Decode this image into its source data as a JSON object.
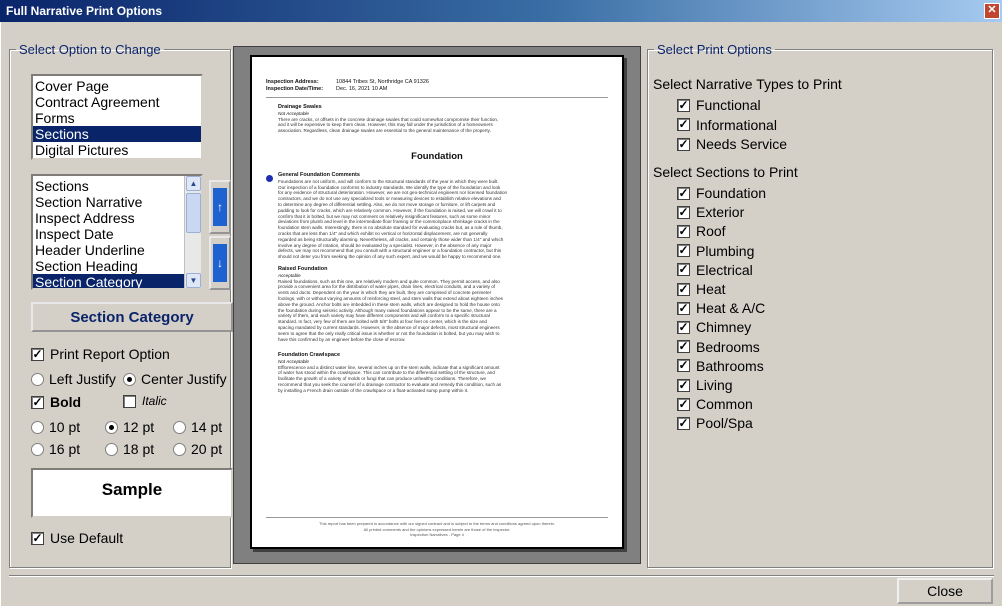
{
  "window": {
    "title": "Full Narrative Print Options",
    "close_glyph": "✕"
  },
  "left_group": {
    "legend": "Select Option to Change",
    "options": [
      {
        "label": "Cover Page",
        "selected": false
      },
      {
        "label": "Contract Agreement",
        "selected": false
      },
      {
        "label": "Forms",
        "selected": false
      },
      {
        "label": "Sections",
        "selected": true
      },
      {
        "label": "Digital Pictures",
        "selected": false
      }
    ],
    "elements": [
      {
        "label": "Sections",
        "selected": false
      },
      {
        "label": "Section Narrative",
        "selected": false
      },
      {
        "label": "Inspect Address",
        "selected": false
      },
      {
        "label": "Inspect Date",
        "selected": false
      },
      {
        "label": "Header Underline",
        "selected": false
      },
      {
        "label": "Section Heading",
        "selected": false
      },
      {
        "label": "Section Category",
        "selected": true
      }
    ],
    "move_up_glyph": "↑",
    "move_down_glyph": "↓",
    "current_heading": "Section Category",
    "print_report_option": {
      "label": "Print Report Option",
      "checked": true
    },
    "justify": {
      "left_label": "Left Justify",
      "center_label": "Center Justify",
      "selected": "center"
    },
    "bold": {
      "label": "Bold",
      "checked": true
    },
    "italic": {
      "label": "Italic",
      "checked": false
    },
    "sizes": [
      {
        "label": "10 pt",
        "selected": false
      },
      {
        "label": "12 pt",
        "selected": true
      },
      {
        "label": "14 pt",
        "selected": false
      },
      {
        "label": "16 pt",
        "selected": false
      },
      {
        "label": "18 pt",
        "selected": false
      },
      {
        "label": "20 pt",
        "selected": false
      }
    ],
    "sample_text": "Sample",
    "use_default": {
      "label": "Use Default",
      "checked": true
    }
  },
  "preview": {
    "address_label": "Inspection Address:",
    "address_value": "10844 Tribes St, Northridge CA 91326",
    "date_label": "Inspection Date/Time:",
    "date_value": "Dec. 16, 2021 10 AM",
    "drainage": {
      "title": "Drainage Swales",
      "status": "Not Acceptable",
      "lines": [
        "There are cracks, or offsets in the concrete drainage swales that could somewhat compromise their function,",
        "and it will be expensive to keep them clean. However, this may fall under the jurisdiction of a homeowners",
        "association. Regardless, clean drainage swales are essential to the general maintenance of the property."
      ]
    },
    "section_heading": "Foundation",
    "general": {
      "title": "General Foundation Comments",
      "lines": [
        "Foundations are not uniform, and will conform to the structural standards of the year in which they were built.",
        "Our inspection of a foundation conforms to industry standards. We identify the type of the foundation and look",
        "for any evidence of structural deterioration. However, we are not geo-technical engineers nor licensed foundation",
        "contractors, and we do not use any specialized tools or measuring devices to establish relative elevations and",
        "to determine any degree of differential settling. Also, we do not move storage or furniture, or lift carpets and",
        "padding to look for cracks, which are relatively common. However, if the foundation is raised, we will crawl it to",
        "confirm that it is bolted, but we may not comment on relatively insignificant features, such as some minor",
        "deviations from plumb and level in the intermediate floor framing or the commonplace shrinkage cracks in the",
        "foundation stem walls. Interestingly, there is no absolute standard for evaluating cracks but, as a rule of thumb,",
        "cracks that are less than 1/4\" and which exhibit no vertical or horizontal displacement, are not generally",
        "regarded as being structurally alarming. Nevertheless, all cracks, and certainly those wider than 1/4\" and which",
        "involve any degree of rotation, should be evaluated by a specialist. However, in the absence of any major",
        "defects, we may not recommend that you consult with a structural engineer or a foundation contractor, but this",
        "should not deter you from seeking the opinion of any such expert, and we would be happy to recommend one."
      ]
    },
    "raised": {
      "title": "Raised Foundation",
      "status": "Acceptable",
      "lines": [
        "Raised foundations, such as this one, are relatively modern and quite common. They permit access, and also",
        "provide a convenient area for the distribution of water pipes, drain lines, electrical conduits, and a variety of",
        "vents and ducts. Dependent on the year in which they are built, they are comprised of concrete perimeter",
        "footings, with or without varying amounts of reinforcing steel, and stem walls that extend about eighteen inches",
        "above the ground. Anchor bolts are imbedded in these stem walls, which are designed to hold the house onto",
        "the foundation during seismic activity. Although many raised foundations appear to be the same, there are a",
        "variety of them, and each variety may have different components and will conform to a specific structural",
        "standard. In fact, very few of them are bolted with 5/8\" bolts at four feet on center, which is the size and",
        "spacing mandated by current standards. However, in the absence of major defects, most structural engineers",
        "seem to agree that the only really critical issue is whether or not the foundation is bolted, but you may wish to",
        "have this confirmed by an engineer before the close of escrow."
      ]
    },
    "crawlspace": {
      "title": "Foundation Crawlspace",
      "status": "Not Acceptable",
      "lines": [
        "Efflorescence and a distinct water line, several inches up on the stem walls, indicate that a significant amount",
        "of water has stood within the crawlspace. This can contribute to the differential settling of the structure, and",
        "facilitate the growth of a variety of molds or fungi that can produce unhealthy conditions. Therefore, we",
        "recommend that you seek the counsel of a drainage contractor to evaluate and remedy this condition, such as",
        "by installing a French drain outside of the crawlspace or a float-activated sump pump within it."
      ]
    },
    "footer_lines": [
      "This report has been prepared in accordance with our signed contract and is subject to the terms and conditions agreed upon therein.",
      "All printed comments and the opinions expressed herein are those of the inspector.",
      "Inspection Narratives - Page 4"
    ]
  },
  "right_group": {
    "legend": "Select Print Options",
    "narrative_title": "Select Narrative Types to Print",
    "narrative_types": [
      {
        "label": "Functional",
        "checked": true
      },
      {
        "label": "Informational",
        "checked": true
      },
      {
        "label": "Needs Service",
        "checked": true
      }
    ],
    "sections_title": "Select Sections to Print",
    "sections": [
      {
        "label": "Foundation",
        "checked": true
      },
      {
        "label": "Exterior",
        "checked": true
      },
      {
        "label": "Roof",
        "checked": true
      },
      {
        "label": "Plumbing",
        "checked": true
      },
      {
        "label": "Electrical",
        "checked": true
      },
      {
        "label": "Heat",
        "checked": true
      },
      {
        "label": "Heat & A/C",
        "checked": true
      },
      {
        "label": "Chimney",
        "checked": true
      },
      {
        "label": "Bedrooms",
        "checked": true
      },
      {
        "label": "Bathrooms",
        "checked": true
      },
      {
        "label": "Living",
        "checked": true
      },
      {
        "label": "Common",
        "checked": true
      },
      {
        "label": "Pool/Spa",
        "checked": true
      }
    ]
  },
  "close_button": "Close",
  "check_glyph": "✓",
  "colors": {
    "title_start": "#0a246a",
    "selection": "#0a246a",
    "legend": "#0a246a",
    "bullet": "#1d2fb0",
    "arrow_button": "#1e62d0"
  }
}
